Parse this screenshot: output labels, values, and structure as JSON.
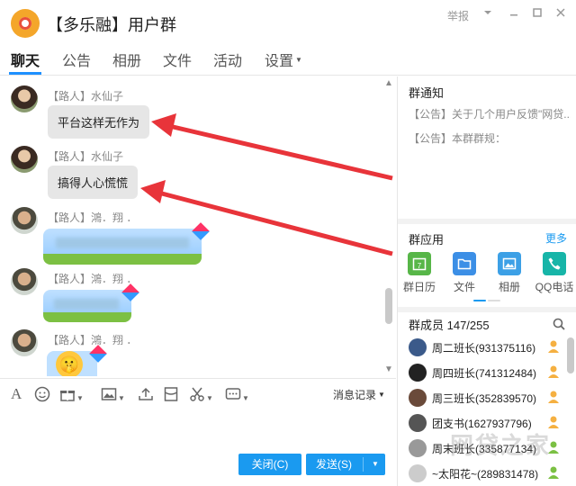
{
  "window": {
    "title": "【多乐融】用户群",
    "report_label": "举报",
    "dropdown_icon": "chevron-down-icon",
    "minimize_icon": "minimize-icon",
    "maximize_icon": "maximize-icon",
    "close_icon": "close-icon"
  },
  "tabs": [
    {
      "label": "聊天",
      "active": true
    },
    {
      "label": "公告"
    },
    {
      "label": "相册"
    },
    {
      "label": "文件"
    },
    {
      "label": "活动"
    },
    {
      "label": "设置"
    }
  ],
  "messages": [
    {
      "sender": "【路人】水仙子",
      "text": "平台这样无作为"
    },
    {
      "sender": "【路人】水仙子",
      "text": "搞得人心慌慌"
    },
    {
      "sender": "【路人】鴻．翔 ．",
      "text": ""
    },
    {
      "sender": "【路人】鴻．翔 ．",
      "text": ""
    },
    {
      "sender": "【路人】鴻．翔 ．",
      "text": ""
    }
  ],
  "toolbar": {
    "icons": [
      "font-icon",
      "emoji-icon",
      "gift-icon",
      "image-icon",
      "upload-icon",
      "red-packet-icon",
      "screenshot-icon",
      "more-icon"
    ],
    "history_label": "消息记录"
  },
  "buttons": {
    "close_label": "关闭(C)",
    "send_label": "发送(S)"
  },
  "group_notice": {
    "title": "群通知",
    "items": [
      "【公告】关于几个用户反馈\"网贷...",
      "【公告】本群群规："
    ]
  },
  "group_apps": {
    "title": "群应用",
    "more_label": "更多",
    "apps": [
      {
        "label": "群日历",
        "icon": "calendar-icon",
        "color": "#57b648"
      },
      {
        "label": "文件",
        "icon": "folder-icon",
        "color": "#3c8fe6"
      },
      {
        "label": "相册",
        "icon": "photo-icon",
        "color": "#3ca0e6"
      },
      {
        "label": "QQ电话",
        "icon": "phone-icon",
        "color": "#17b5a8"
      }
    ]
  },
  "members": {
    "title": "群成员 147/255",
    "list": [
      {
        "name": "周二班长(931375116)"
      },
      {
        "name": "周四班长(741312484)"
      },
      {
        "name": "周三班长(352839570)"
      },
      {
        "name": "团支书(1627937796)"
      },
      {
        "name": "周末班长(335877134)"
      },
      {
        "name": "~太阳花~(289831478)"
      }
    ]
  },
  "watermark": "网贷之家",
  "colors": {
    "accent": "#1a9af0",
    "arrow": "#e8343a"
  }
}
